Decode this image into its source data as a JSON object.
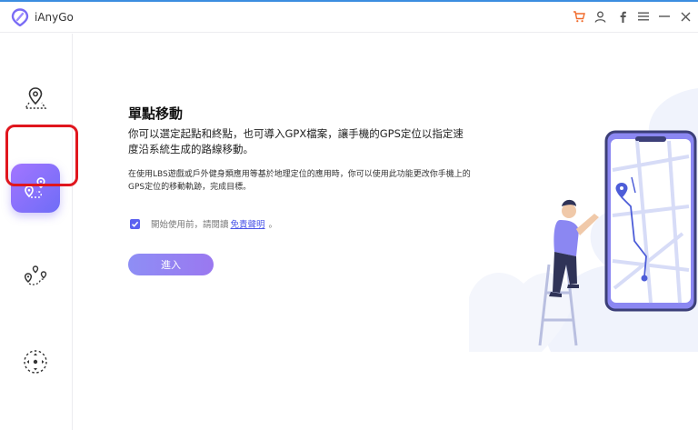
{
  "app": {
    "name": "iAnyGo"
  },
  "titlebar": {
    "icons": [
      "cart-icon",
      "user-icon",
      "facebook-icon",
      "menu-icon",
      "minimize-icon",
      "close-icon"
    ]
  },
  "sidebar": {
    "items": [
      {
        "name": "single-location-change",
        "icon": "location-pin-icon"
      },
      {
        "name": "single-point-movement",
        "icon": "route-pins-icon",
        "active": true
      },
      {
        "name": "multi-point-movement",
        "icon": "multi-route-icon"
      },
      {
        "name": "joystick-movement",
        "icon": "joystick-icon"
      }
    ]
  },
  "main": {
    "title": "單點移動",
    "description": "你可以選定起點和終點，也可導入GPX檔案，讓手機的GPS定位以指定速度沿系統生成的路線移動。",
    "note": "在使用LBS遊戲或戶外健身類應用等基於地理定位的應用時，你可以使用此功能更改你手機上的GPS定位的移動軌跡，完成目標。",
    "agreement": {
      "checked": true,
      "text": "開始使用前，請閱讀",
      "link": "免責聲明",
      "suffix": "。"
    },
    "enter_button": "進入"
  },
  "colors": {
    "accent": "#6f6df7",
    "highlight": "#e0161e",
    "cart": "#f06a2a"
  }
}
